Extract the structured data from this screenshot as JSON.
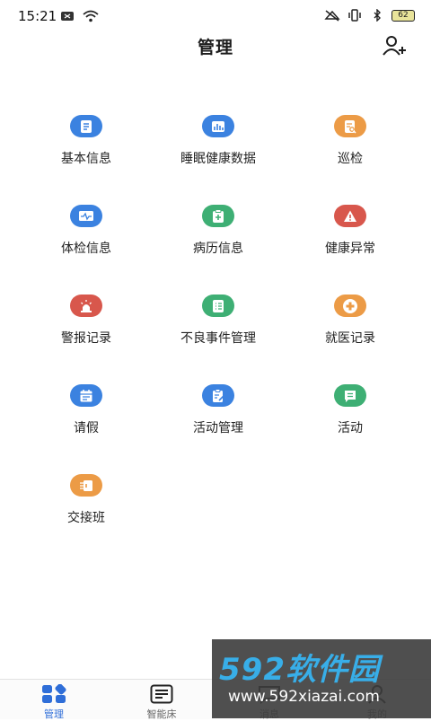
{
  "status_bar": {
    "time": "15:21",
    "battery": "62"
  },
  "header": {
    "title": "管理"
  },
  "grid": [
    {
      "label": "基本信息",
      "icon": "document-icon",
      "color": "#3b82e0"
    },
    {
      "label": "睡眠健康数据",
      "icon": "bar-chart-icon",
      "color": "#3b82e0"
    },
    {
      "label": "巡检",
      "icon": "inspect-icon",
      "color": "#ec9b46"
    },
    {
      "label": "体检信息",
      "icon": "pulse-monitor-icon",
      "color": "#3b82e0"
    },
    {
      "label": "病历信息",
      "icon": "medical-record-icon",
      "color": "#3eaf74"
    },
    {
      "label": "健康异常",
      "icon": "warning-icon",
      "color": "#d8574c"
    },
    {
      "label": "警报记录",
      "icon": "alarm-light-icon",
      "color": "#d8574c"
    },
    {
      "label": "不良事件管理",
      "icon": "list-icon",
      "color": "#3eaf74"
    },
    {
      "label": "就医记录",
      "icon": "medical-cross-icon",
      "color": "#ec9b46"
    },
    {
      "label": "请假",
      "icon": "calendar-icon",
      "color": "#3b82e0"
    },
    {
      "label": "活动管理",
      "icon": "clipboard-edit-icon",
      "color": "#3b82e0"
    },
    {
      "label": "活动",
      "icon": "message-icon",
      "color": "#3eaf74"
    },
    {
      "label": "交接班",
      "icon": "handover-icon",
      "color": "#ec9b46"
    }
  ],
  "bottom_nav": [
    {
      "label": "管理",
      "icon": "grid-icon",
      "active": true
    },
    {
      "label": "智能床",
      "icon": "bed-list-icon",
      "active": false
    },
    {
      "label": "消息",
      "icon": "message-icon",
      "active": false
    },
    {
      "label": "我的",
      "icon": "person-icon",
      "active": false
    }
  ],
  "watermark": {
    "logo": "592软件园",
    "url": "www.592xiazai.com"
  },
  "colors": {
    "accent": "#2f6ed8",
    "blue": "#3b82e0",
    "green": "#3eaf74",
    "orange": "#ec9b46",
    "red": "#d8574c"
  }
}
